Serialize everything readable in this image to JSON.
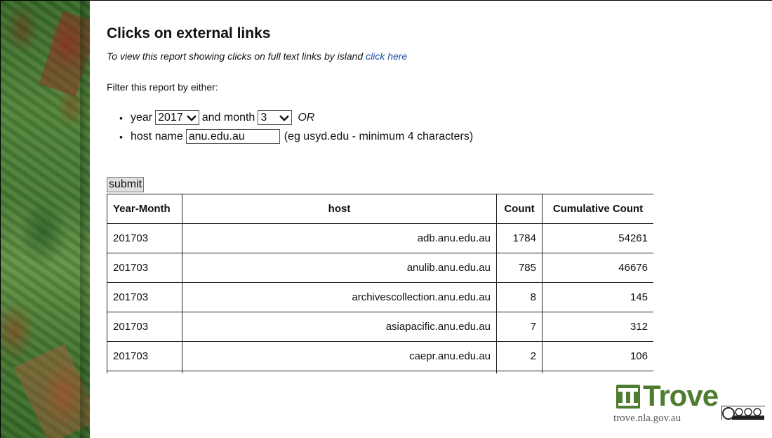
{
  "page": {
    "title": "Clicks on external links",
    "subtitle_text": "To view this report showing clicks on full text links by island ",
    "subtitle_link": "click here",
    "filter_intro": "Filter this report by either:"
  },
  "filters": {
    "year_label": "year",
    "year_value": "2017",
    "and_month_label": "and month",
    "month_value": "3",
    "or_label": "OR",
    "host_label": "host name",
    "host_value": "anu.edu.au",
    "host_hint": "(eg usyd.edu - minimum 4 characters)"
  },
  "submit_label": "submit",
  "table": {
    "headers": [
      "Year-Month",
      "host",
      "Count",
      "Cumulative Count"
    ],
    "rows": [
      [
        "201703",
        "adb.anu.edu.au",
        "1784",
        "54261"
      ],
      [
        "201703",
        "anulib.anu.edu.au",
        "785",
        "46676"
      ],
      [
        "201703",
        "archivescollection.anu.edu.au",
        "8",
        "145"
      ],
      [
        "201703",
        "asiapacific.anu.edu.au",
        "7",
        "312"
      ],
      [
        "201703",
        "caepr.anu.edu.au",
        "2",
        "106"
      ],
      [
        "",
        "",
        "",
        ""
      ]
    ]
  },
  "logo": {
    "name": "Trove",
    "url": "trove.nla.gov.au"
  },
  "colors": {
    "link": "#1f4fa8",
    "brand_green": "#4e7d2f"
  }
}
